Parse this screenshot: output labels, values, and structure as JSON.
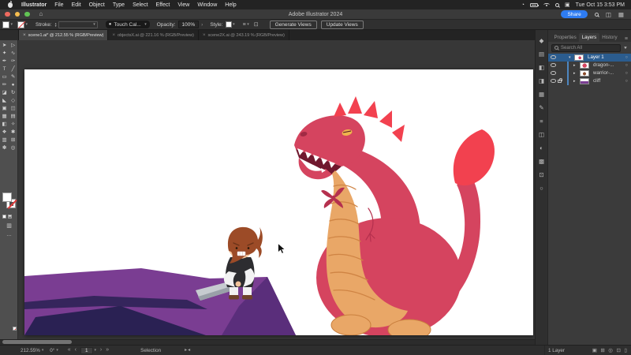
{
  "menubar": {
    "items": [
      "Illustrator",
      "File",
      "Edit",
      "Object",
      "Type",
      "Select",
      "Effect",
      "View",
      "Window",
      "Help"
    ],
    "time": "Tue Oct 15  3:53 PM"
  },
  "titlebar": {
    "title": "Adobe Illustrator 2024",
    "share_label": "Share"
  },
  "controlbar": {
    "stroke_label": "Stroke:",
    "brush_preset": "Touch Cal...",
    "opacity_label": "Opacity:",
    "opacity_value": "100%",
    "style_label": "Style:",
    "generate_views_label": "Generate Views",
    "update_views_label": "Update Views"
  },
  "tabbar": {
    "tabs": [
      {
        "label": "scene1.ai* @ 212.55 % (RGB/Preview)",
        "active": true
      },
      {
        "label": "objectsX.ai @ 221.16 % (RGB/Preview)",
        "active": false
      },
      {
        "label": "scene2X.ai @ 243.19 % (RGB/Preview)",
        "active": false
      }
    ]
  },
  "toolbar": {
    "tools": [
      {
        "name": "selection-tool",
        "glyph": "➤"
      },
      {
        "name": "direct-selection-tool",
        "glyph": "▷"
      },
      {
        "name": "magic-wand-tool",
        "glyph": "✦"
      },
      {
        "name": "lasso-tool",
        "glyph": "∿"
      },
      {
        "name": "pen-tool",
        "glyph": "✒"
      },
      {
        "name": "curvature-tool",
        "glyph": "✑"
      },
      {
        "name": "type-tool",
        "glyph": "T"
      },
      {
        "name": "line-segment-tool",
        "glyph": "╱"
      },
      {
        "name": "rectangle-tool",
        "glyph": "▭"
      },
      {
        "name": "paintbrush-tool",
        "glyph": "✎"
      },
      {
        "name": "pencil-tool",
        "glyph": "✏"
      },
      {
        "name": "blob-brush-tool",
        "glyph": "●"
      },
      {
        "name": "eraser-tool",
        "glyph": "◪"
      },
      {
        "name": "rotate-tool",
        "glyph": "↻"
      },
      {
        "name": "scale-tool",
        "glyph": "◣"
      },
      {
        "name": "width-tool",
        "glyph": "◇"
      },
      {
        "name": "free-transform-tool",
        "glyph": "▣"
      },
      {
        "name": "shape-builder-tool",
        "glyph": "◫"
      },
      {
        "name": "perspective-grid-tool",
        "glyph": "▦"
      },
      {
        "name": "mesh-tool",
        "glyph": "▤"
      },
      {
        "name": "gradient-tool",
        "glyph": "◧"
      },
      {
        "name": "eyedropper-tool",
        "glyph": "✧"
      },
      {
        "name": "blend-tool",
        "glyph": "❖"
      },
      {
        "name": "symbol-sprayer-tool",
        "glyph": "✱"
      },
      {
        "name": "column-graph-tool",
        "glyph": "▥"
      },
      {
        "name": "artboard-tool",
        "glyph": "⊞"
      },
      {
        "name": "hand-tool",
        "glyph": "✽"
      },
      {
        "name": "zoom-tool",
        "glyph": "◎"
      }
    ],
    "more_label": "…"
  },
  "right_strip": {
    "icons": [
      {
        "name": "shape-properties-icon",
        "glyph": "◆"
      },
      {
        "name": "libraries-icon",
        "glyph": "▤"
      },
      {
        "name": "color-icon",
        "glyph": "◧"
      },
      {
        "name": "color-guide-icon",
        "glyph": "◨"
      },
      {
        "name": "swatches-icon",
        "glyph": "▦"
      },
      {
        "name": "brushes-icon",
        "glyph": "✎"
      },
      {
        "name": "stroke-panel-icon",
        "glyph": "≡"
      },
      {
        "name": "layers-panel-icon",
        "glyph": "◫"
      },
      {
        "name": "gradient-panel-icon",
        "glyph": "◐"
      },
      {
        "name": "transparency-icon",
        "glyph": "▩"
      },
      {
        "name": "export-icon",
        "glyph": "⊡"
      },
      {
        "name": "comments-icon",
        "glyph": "○"
      }
    ]
  },
  "layers_panel": {
    "tabs": [
      "Properties",
      "Layers",
      "History"
    ],
    "active_tab": "Layers",
    "search_placeholder": "Search All",
    "rows": [
      {
        "name": "Layer 1",
        "selected": true,
        "expanded": true,
        "locked": false
      },
      {
        "name": "dragon-...",
        "selected": false,
        "expanded": false,
        "locked": false
      },
      {
        "name": "warrior-...",
        "selected": false,
        "expanded": false,
        "locked": false
      },
      {
        "name": "cliff",
        "selected": false,
        "expanded": false,
        "locked": true
      }
    ],
    "footer_count": "1 Layer",
    "footer_icons": [
      {
        "name": "make-clipping-mask-icon",
        "glyph": "▣"
      },
      {
        "name": "new-sublayer-icon",
        "glyph": "⊞"
      },
      {
        "name": "locate-object-icon",
        "glyph": "◎"
      },
      {
        "name": "new-layer-icon",
        "glyph": "⊡"
      },
      {
        "name": "delete-layer-icon",
        "glyph": "▯"
      }
    ]
  },
  "statusbar": {
    "zoom": "212.55%",
    "rotation": "0°",
    "artboard": "1",
    "tool": "Selection"
  },
  "icons": {
    "close": "×",
    "dropdown": "▾",
    "stepper_up": "▴",
    "stepper_down": "▾",
    "panel_arrow": "›",
    "chevron_open": "▾",
    "chevron_closed": "▸",
    "target_circle": "○",
    "menu": "≡",
    "filter": "▼",
    "home": "⌂",
    "gauge": "◔",
    "control_center": "▣",
    "align": "≡",
    "arrange": "⊡",
    "screen_mode": "▥",
    "brush_dot": "●",
    "nav_first": "«",
    "nav_prev": "‹",
    "nav_next": "›",
    "nav_last": "»",
    "history_fwd": "▸",
    "history_back": "◂"
  },
  "artwork": {
    "description": "Cartoon scene: small angry knight holding a sword on a faceted purple cliff, facing a large crimson dragon with red crest spikes, tan belly plates and a flame-tipped tail, on a white artboard.",
    "colors": {
      "dragon_body": "#d5445f",
      "dragon_crest": "#f2414f",
      "dragon_belly": "#e9a767",
      "dragon_belly_line": "#cf8444",
      "dragon_eye": "#efb44d",
      "cliff": "#7a3d92",
      "cliff_shadow": "#2a2153",
      "knight_hair": "#9c4b27",
      "knight_skin": "#f3c49b",
      "knight_tunic": "#2d2d30",
      "sword": "#c6cbd0"
    }
  }
}
